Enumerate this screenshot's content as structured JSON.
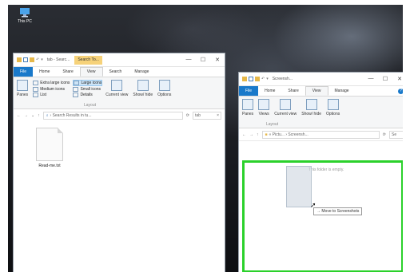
{
  "desktop": {
    "icon_label": "This PC"
  },
  "left_window": {
    "title": "tab - Searc...",
    "context_tab": "Search To...",
    "window_controls": [
      "—",
      "☐",
      "✕"
    ],
    "ribbon_tabs": [
      "File",
      "Home",
      "Share",
      "View",
      "Search",
      "Manage"
    ],
    "active_tab": "View",
    "ribbon": {
      "panes_label": "Panes",
      "layout_items": [
        "Extra large icons",
        "Large icons",
        "Medium icons",
        "Small icons",
        "List",
        "Details"
      ],
      "selected_layout": "Large icons",
      "current_view_label": "Current view",
      "show_hide_label": "Show/ hide",
      "options_label": "Options",
      "group_label": "Layout"
    },
    "address": {
      "path": "› Search Results in tu...",
      "search_placeholder": "tab"
    },
    "file": {
      "name": "Read-me.txt"
    }
  },
  "right_window": {
    "title": "Screensh...",
    "context_tab": "Picture Tools",
    "window_controls": [
      "—",
      "☐",
      "✕"
    ],
    "ribbon_tabs": [
      "File",
      "Home",
      "Share",
      "View",
      "Manage"
    ],
    "active_tab": "View",
    "ribbon": {
      "panes_label": "Panes",
      "views_label": "Views",
      "current_view_label": "Current view",
      "show_hide_label": "Show/ hide",
      "options_label": "Options",
      "group_label": "Layout"
    },
    "address": {
      "path": "« Pictu... › Screensh...",
      "search_placeholder": "Se"
    },
    "empty_text": "This folder is empty.",
    "drag_tip": "→ Move to Screenshots"
  },
  "colors": {
    "file_tab": "#1979ca",
    "context_tab": "#f6d27a",
    "drop_highlight": "#2bd12b"
  }
}
